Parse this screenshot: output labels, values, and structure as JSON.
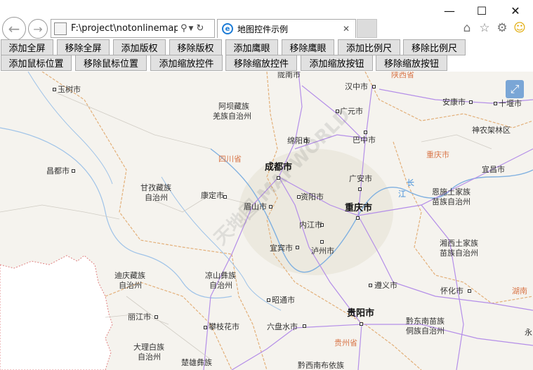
{
  "window": {
    "minimize_glyph": "—",
    "maximize_glyph": "☐",
    "close_glyph": "✕"
  },
  "nav": {
    "back_glyph": "←",
    "forward_glyph": "→",
    "address": "F:\\project\\notonlinemap\\r",
    "search_glyph": "⚲",
    "dropdown_glyph": "▼",
    "refresh_glyph": "↻"
  },
  "tab": {
    "title": "地图控件示例",
    "icon": "e",
    "close_glyph": "✕"
  },
  "tools": {
    "home_glyph": "⌂",
    "star_glyph": "☆",
    "gear_glyph": "⚙",
    "smiley_glyph": "☺"
  },
  "buttons": {
    "row1": [
      "添加全屏",
      "移除全屏",
      "添加版权",
      "移除版权",
      "添加鹰眼",
      "移除鹰眼",
      "添加比例尺",
      "移除比例尺"
    ],
    "row2": [
      "添加鼠标位置",
      "移除鼠标位置",
      "添加缩放控件",
      "移除缩放控件",
      "添加缩放按钮",
      "移除缩放按钮"
    ]
  },
  "map": {
    "fullscreen_glyph": "⤢",
    "watermark": "天地图 MAPWORLD",
    "labels": [
      {
        "text": "陇南市",
        "kind": "city"
      },
      {
        "text": "陕西省",
        "kind": "prov"
      },
      {
        "text": "玉树市",
        "kind": "city"
      },
      {
        "text": "汉中市",
        "kind": "city"
      },
      {
        "text": "安康市",
        "kind": "city"
      },
      {
        "text": "十堰市",
        "kind": "city"
      },
      {
        "text": "阿坝藏族",
        "kind": "city"
      },
      {
        "text": "羌族自治州",
        "kind": "city"
      },
      {
        "text": "广元市",
        "kind": "city"
      },
      {
        "text": "神农架林区",
        "kind": "city"
      },
      {
        "text": "绵阳市",
        "kind": "city"
      },
      {
        "text": "巴中市",
        "kind": "city"
      },
      {
        "text": "重庆市",
        "kind": "prov"
      },
      {
        "text": "四川省",
        "kind": "prov"
      },
      {
        "text": "昌都市",
        "kind": "city"
      },
      {
        "text": "成都市",
        "kind": "big"
      },
      {
        "text": "宜昌市",
        "kind": "city"
      },
      {
        "text": "广安市",
        "kind": "city"
      },
      {
        "text": "长",
        "kind": "river"
      },
      {
        "text": "江",
        "kind": "river"
      },
      {
        "text": "甘孜藏族",
        "kind": "city"
      },
      {
        "text": "自治州",
        "kind": "city"
      },
      {
        "text": "康定市",
        "kind": "city"
      },
      {
        "text": "资阳市",
        "kind": "city"
      },
      {
        "text": "恩施土家族",
        "kind": "city"
      },
      {
        "text": "苗族自治州",
        "kind": "city"
      },
      {
        "text": "眉山市",
        "kind": "city"
      },
      {
        "text": "重庆市",
        "kind": "big"
      },
      {
        "text": "内江市",
        "kind": "city"
      },
      {
        "text": "湘西土家族",
        "kind": "city"
      },
      {
        "text": "苗族自治州",
        "kind": "city"
      },
      {
        "text": "宜宾市",
        "kind": "city"
      },
      {
        "text": "泸州市",
        "kind": "city"
      },
      {
        "text": "迪庆藏族",
        "kind": "city"
      },
      {
        "text": "自治州",
        "kind": "city"
      },
      {
        "text": "凉山彝族",
        "kind": "city"
      },
      {
        "text": "自治州",
        "kind": "city"
      },
      {
        "text": "遵义市",
        "kind": "city"
      },
      {
        "text": "怀化市",
        "kind": "city"
      },
      {
        "text": "湖南",
        "kind": "prov"
      },
      {
        "text": "昭通市",
        "kind": "city"
      },
      {
        "text": "丽江市",
        "kind": "city"
      },
      {
        "text": "贵阳市",
        "kind": "big"
      },
      {
        "text": "攀枝花市",
        "kind": "city"
      },
      {
        "text": "六盘水市",
        "kind": "city"
      },
      {
        "text": "黔东南苗族",
        "kind": "city"
      },
      {
        "text": "侗族自治州",
        "kind": "city"
      },
      {
        "text": "贵州省",
        "kind": "prov"
      },
      {
        "text": "大理白族",
        "kind": "city"
      },
      {
        "text": "自治州",
        "kind": "city"
      },
      {
        "text": "楚雄彝族",
        "kind": "city"
      },
      {
        "text": "黔西南布依族",
        "kind": "city"
      },
      {
        "text": "永",
        "kind": "city"
      }
    ]
  }
}
